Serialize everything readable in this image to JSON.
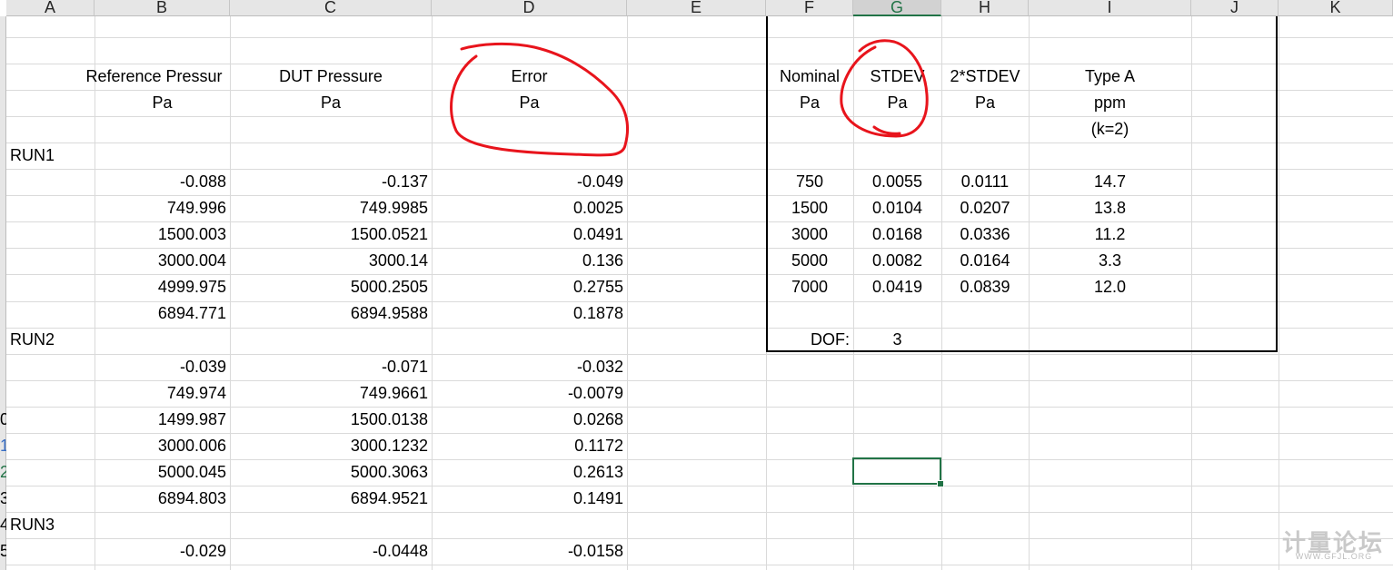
{
  "columns": [
    "A",
    "B",
    "C",
    "D",
    "E",
    "F",
    "G",
    "H",
    "I",
    "J",
    "K"
  ],
  "selected_column": "G",
  "row_numbers": {
    "r14": "0",
    "r15": "1",
    "r16": "2",
    "r17": "3",
    "r19": "4",
    "r20": "5"
  },
  "headers": {
    "ref_pressure": "Reference Pressur",
    "dut_pressure": "DUT Pressure",
    "error": "Error",
    "unit_pa": "Pa",
    "nominal": "Nominal",
    "stdev": "STDEV",
    "two_stdev": "2*STDEV",
    "type_a": "Type A",
    "ppm": "ppm",
    "k2": "(k=2)"
  },
  "runs": [
    {
      "label": "RUN1",
      "rows": [
        {
          "ref": "-0.088",
          "dut": "-0.137",
          "err": "-0.049"
        },
        {
          "ref": "749.996",
          "dut": "749.9985",
          "err": "0.0025"
        },
        {
          "ref": "1500.003",
          "dut": "1500.0521",
          "err": "0.0491"
        },
        {
          "ref": "3000.004",
          "dut": "3000.14",
          "err": "0.136"
        },
        {
          "ref": "4999.975",
          "dut": "5000.2505",
          "err": "0.2755"
        },
        {
          "ref": "6894.771",
          "dut": "6894.9588",
          "err": "0.1878"
        }
      ]
    },
    {
      "label": "RUN2",
      "rows": [
        {
          "ref": "-0.039",
          "dut": "-0.071",
          "err": "-0.032"
        },
        {
          "ref": "749.974",
          "dut": "749.9661",
          "err": "-0.0079"
        },
        {
          "ref": "1499.987",
          "dut": "1500.0138",
          "err": "0.0268"
        },
        {
          "ref": "3000.006",
          "dut": "3000.1232",
          "err": "0.1172"
        },
        {
          "ref": "5000.045",
          "dut": "5000.3063",
          "err": "0.2613"
        },
        {
          "ref": "6894.803",
          "dut": "6894.9521",
          "err": "0.1491"
        }
      ]
    },
    {
      "label": "RUN3",
      "rows": [
        {
          "ref": "-0.029",
          "dut": "-0.0448",
          "err": "-0.0158"
        }
      ]
    }
  ],
  "summary": [
    {
      "nominal": "750",
      "stdev": "0.0055",
      "two_stdev": "0.0111",
      "type_a": "14.7"
    },
    {
      "nominal": "1500",
      "stdev": "0.0104",
      "two_stdev": "0.0207",
      "type_a": "13.8"
    },
    {
      "nominal": "3000",
      "stdev": "0.0168",
      "two_stdev": "0.0336",
      "type_a": "11.2"
    },
    {
      "nominal": "5000",
      "stdev": "0.0082",
      "two_stdev": "0.0164",
      "type_a": "3.3"
    },
    {
      "nominal": "7000",
      "stdev": "0.0419",
      "two_stdev": "0.0839",
      "type_a": "12.0"
    }
  ],
  "dof_label": "DOF:",
  "dof_value": "3",
  "watermark": {
    "text": "计量论坛",
    "url": "WWW.GFJL.ORG"
  },
  "colors": {
    "selection": "#217346",
    "annotation": "#e8141c",
    "gridline": "#dadada"
  }
}
